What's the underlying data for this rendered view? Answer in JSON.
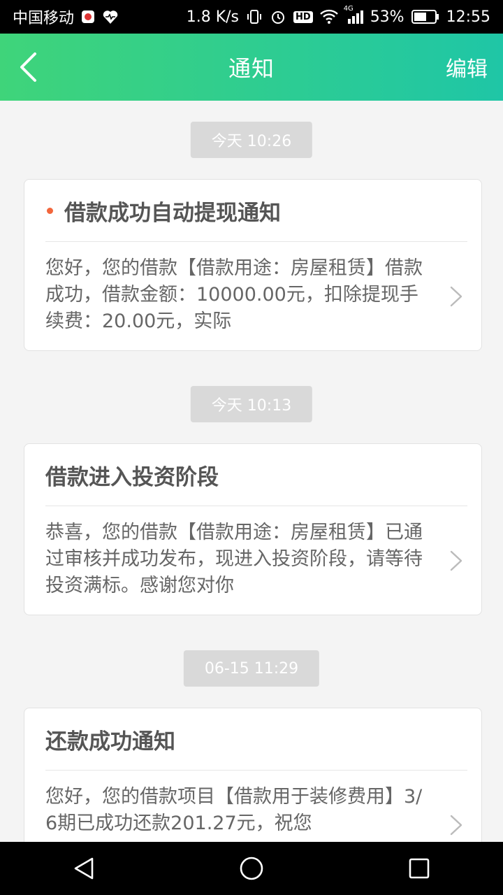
{
  "status_bar": {
    "carrier": "中国移动",
    "network_speed": "1.8 K/s",
    "battery": "53%",
    "time": "12:55",
    "hd_label": "HD",
    "lte_label": "4G"
  },
  "header": {
    "title": "通知",
    "edit_label": "编辑"
  },
  "notifications": [
    {
      "time": "今天 10:26",
      "title": "借款成功自动提现通知",
      "unread": true,
      "body": "您好，您的借款【借款用途：房屋租赁】借款成功，借款金额：10000.00元，扣除提现手续费：20.00元，实际"
    },
    {
      "time": "今天 10:13",
      "title": "借款进入投资阶段",
      "unread": false,
      "body": "恭喜，您的借款【借款用途：房屋租赁】已通过审核并成功发布，现进入投资阶段，请等待投资满标。感谢您对你"
    },
    {
      "time": "06-15 11:29",
      "title": "还款成功通知",
      "unread": false,
      "body": "您好，您的借款项目【借款用于装修费用】3/6期已成功还款201.27元，祝您"
    }
  ],
  "colors": {
    "header_gradient_start": "#3fd47a",
    "header_gradient_end": "#1fc6a6",
    "unread_dot": "#f2663c"
  }
}
